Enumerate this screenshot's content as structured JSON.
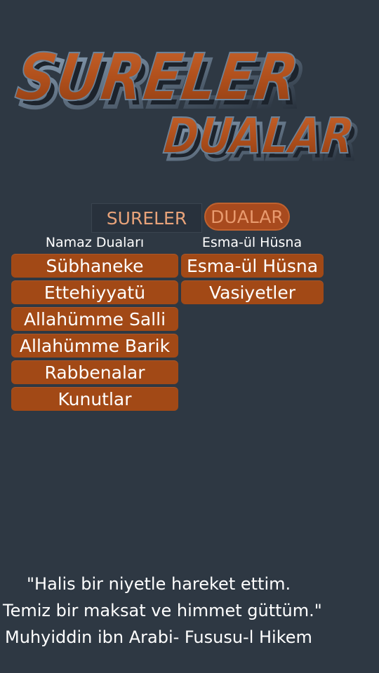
{
  "logo": {
    "line1": "SURELER",
    "line2": "DUALAR",
    "face_color": "#b4521f",
    "edge_color": "#5a6c80"
  },
  "tabs": [
    {
      "label": "SURELER",
      "selected": false
    },
    {
      "label": "DUALAR",
      "selected": true
    }
  ],
  "columns": {
    "left": {
      "header": "Namaz Duaları",
      "items": [
        "Sübhaneke",
        "Ettehiyyatü",
        "Allahümme Salli",
        "Allahümme Barik",
        "Rabbenalar",
        "Kunutlar"
      ]
    },
    "right": {
      "header": "Esma-ül Hüsna",
      "items": [
        "Esma-ül Hüsna",
        "Vasiyetler"
      ]
    }
  },
  "quote": {
    "line1": "\"Halis bir niyetle hareket ettim.",
    "line2": "Temiz bir maksat ve himmet güttüm.\"",
    "line3": "Muhyiddin ibn Arabi- Fususu-l Hikem"
  },
  "colors": {
    "background": "#2e3843",
    "button": "#a24916",
    "tab_active": "#a84a1e",
    "tab_text": "#e8a37a"
  }
}
